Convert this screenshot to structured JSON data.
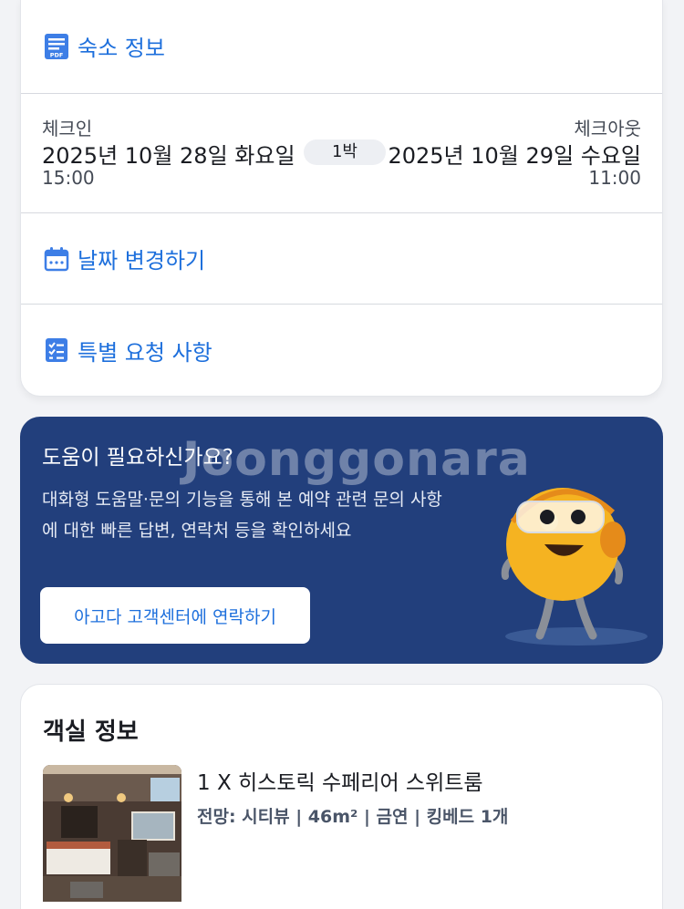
{
  "property_info": {
    "label": "숙소 정보",
    "icon": "pdf-document-icon"
  },
  "stay": {
    "checkin_label": "체크인",
    "checkin_date": "2025년 10월 28일 화요일",
    "checkin_time": "15:00",
    "nights": "1박",
    "checkout_label": "체크아웃",
    "checkout_date": "2025년 10월 29일 수요일",
    "checkout_time": "11:00"
  },
  "change_dates": {
    "label": "날짜 변경하기",
    "icon": "calendar-icon"
  },
  "special_requests": {
    "label": "특별 요청 사항",
    "icon": "checklist-icon"
  },
  "help": {
    "title": "도움이 필요하신가요?",
    "description": "대화형 도움말·문의 기능을 통해 본 예약 관련 문의 사항에 대한 빠른 답변, 연락처 등을 확인하세요",
    "button": "아고다 고객센터에 연락하기",
    "mascot": "support-mascot-illustration"
  },
  "watermark": "Joonggonara",
  "room": {
    "section_title": "객실 정보",
    "name": "1 X 히스토릭 수페리어 스위트룸",
    "info": "전망: 시티뷰 | 46m² | 금연 | 킹베드 1개"
  },
  "colors": {
    "accent": "#1d6fdc",
    "help_bg": "#223f7c",
    "mascot": "#f5b321"
  }
}
